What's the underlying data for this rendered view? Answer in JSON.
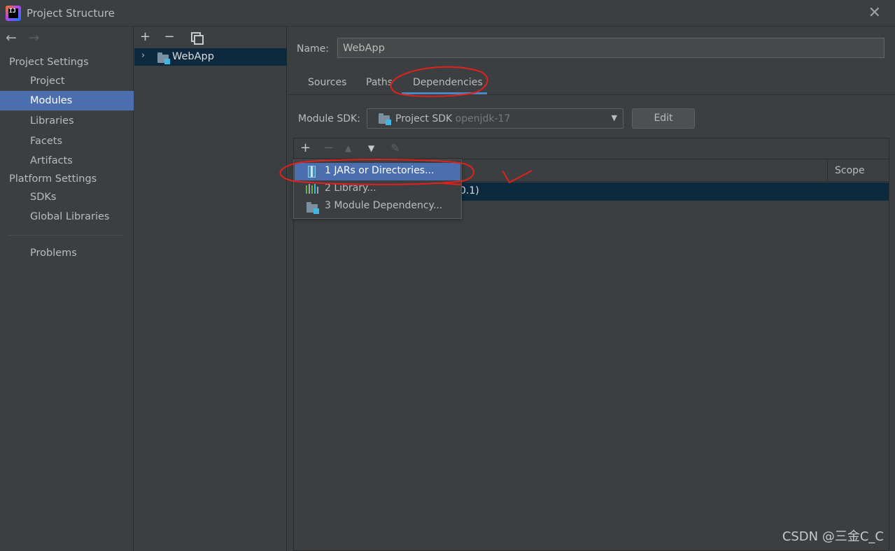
{
  "window": {
    "title": "Project Structure",
    "icon_text": "IJ",
    "close_glyph": "✕"
  },
  "nav": {
    "back_glyph": "←",
    "forward_glyph": "→",
    "project_settings_header": "Project Settings",
    "project_settings_items": [
      "Project",
      "Modules",
      "Libraries",
      "Facets",
      "Artifacts"
    ],
    "platform_settings_header": "Platform Settings",
    "platform_settings_items": [
      "SDKs",
      "Global Libraries"
    ],
    "problems": "Problems",
    "selected": "Modules"
  },
  "tree": {
    "toolbar": {
      "add": "+",
      "remove": "−"
    },
    "expand_glyph": "›",
    "module_name": "WebApp"
  },
  "module": {
    "name_label": "Name:",
    "name_value": "WebApp",
    "tabs": [
      "Sources",
      "Paths",
      "Dependencies"
    ],
    "active_tab": "Dependencies"
  },
  "dependencies": {
    "sdk_label": "Module SDK:",
    "sdk_value": "Project SDK",
    "sdk_detail": "openjdk-17",
    "dropdown_glyph": "▼",
    "edit_button": "Edit",
    "toolbar": {
      "add": "+",
      "remove": "−",
      "up": "▲",
      "down": "▼",
      "edit": "✎"
    },
    "scope_header": "Scope",
    "row_fragment": "0.1)"
  },
  "popup_menu": {
    "items": [
      {
        "label": "1  JARs or Directories...",
        "icon": "jar-icon",
        "selected": true
      },
      {
        "label": "2  Library...",
        "icon": "library-icon",
        "selected": false
      },
      {
        "label": "3  Module Dependency...",
        "icon": "module-folder-icon",
        "selected": false
      }
    ]
  },
  "watermark": "CSDN @三金C_C",
  "colors": {
    "background": "#3c3f41",
    "selection": "#4b6eaf",
    "tree_selection": "#0d293e",
    "tab_underline": "#4a88c7",
    "annotation_red": "#e2211c"
  }
}
